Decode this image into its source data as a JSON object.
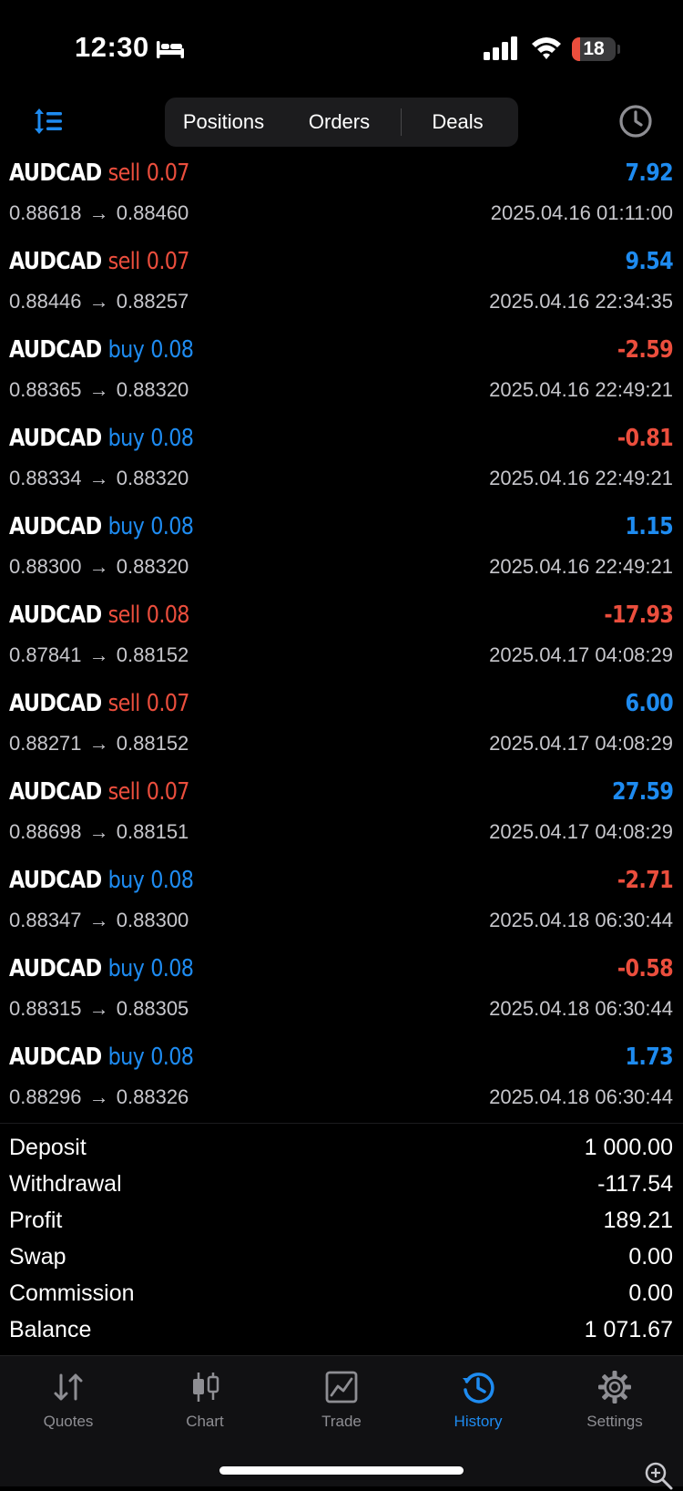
{
  "status_bar": {
    "time": "12:30",
    "battery_level": "18",
    "battery_fraction": 0.18
  },
  "colors": {
    "accent_blue": "#1e8bf0",
    "loss_red": "#eb4e3d",
    "background": "#000000",
    "secondary_text": "#c7c7cc"
  },
  "toolbar": {
    "segments": [
      "Positions",
      "Orders",
      "Deals"
    ],
    "active_segment": "Positions",
    "left_icon": "sort-lines-icon",
    "right_icon": "clock-history-icon"
  },
  "deals": [
    {
      "symbol": "AUDCAD",
      "side": "sell",
      "volume": "0.07",
      "open": "0.88618",
      "close": "0.88460",
      "profit": "7.92",
      "time": "2025.04.16 01:11:00"
    },
    {
      "symbol": "AUDCAD",
      "side": "sell",
      "volume": "0.07",
      "open": "0.88446",
      "close": "0.88257",
      "profit": "9.54",
      "time": "2025.04.16 22:34:35"
    },
    {
      "symbol": "AUDCAD",
      "side": "buy",
      "volume": "0.08",
      "open": "0.88365",
      "close": "0.88320",
      "profit": "-2.59",
      "time": "2025.04.16 22:49:21"
    },
    {
      "symbol": "AUDCAD",
      "side": "buy",
      "volume": "0.08",
      "open": "0.88334",
      "close": "0.88320",
      "profit": "-0.81",
      "time": "2025.04.16 22:49:21"
    },
    {
      "symbol": "AUDCAD",
      "side": "buy",
      "volume": "0.08",
      "open": "0.88300",
      "close": "0.88320",
      "profit": "1.15",
      "time": "2025.04.16 22:49:21"
    },
    {
      "symbol": "AUDCAD",
      "side": "sell",
      "volume": "0.08",
      "open": "0.87841",
      "close": "0.88152",
      "profit": "-17.93",
      "time": "2025.04.17 04:08:29"
    },
    {
      "symbol": "AUDCAD",
      "side": "sell",
      "volume": "0.07",
      "open": "0.88271",
      "close": "0.88152",
      "profit": "6.00",
      "time": "2025.04.17 04:08:29"
    },
    {
      "symbol": "AUDCAD",
      "side": "sell",
      "volume": "0.07",
      "open": "0.88698",
      "close": "0.88151",
      "profit": "27.59",
      "time": "2025.04.17 04:08:29"
    },
    {
      "symbol": "AUDCAD",
      "side": "buy",
      "volume": "0.08",
      "open": "0.88347",
      "close": "0.88300",
      "profit": "-2.71",
      "time": "2025.04.18 06:30:44"
    },
    {
      "symbol": "AUDCAD",
      "side": "buy",
      "volume": "0.08",
      "open": "0.88315",
      "close": "0.88305",
      "profit": "-0.58",
      "time": "2025.04.18 06:30:44"
    },
    {
      "symbol": "AUDCAD",
      "side": "buy",
      "volume": "0.08",
      "open": "0.88296",
      "close": "0.88326",
      "profit": "1.73",
      "time": "2025.04.18 06:30:44"
    }
  ],
  "summary": [
    {
      "label": "Deposit",
      "value": "1 000.00"
    },
    {
      "label": "Withdrawal",
      "value": "-117.54"
    },
    {
      "label": "Profit",
      "value": "189.21"
    },
    {
      "label": "Swap",
      "value": "0.00"
    },
    {
      "label": "Commission",
      "value": "0.00"
    },
    {
      "label": "Balance",
      "value": "1 071.67"
    }
  ],
  "tab_bar": {
    "tabs": [
      {
        "label": "Quotes",
        "icon": "quotes-arrows-icon"
      },
      {
        "label": "Chart",
        "icon": "candlestick-icon"
      },
      {
        "label": "Trade",
        "icon": "trade-chart-icon"
      },
      {
        "label": "History",
        "icon": "history-clock-icon"
      },
      {
        "label": "Settings",
        "icon": "gear-icon"
      }
    ],
    "active_tab": "History"
  }
}
